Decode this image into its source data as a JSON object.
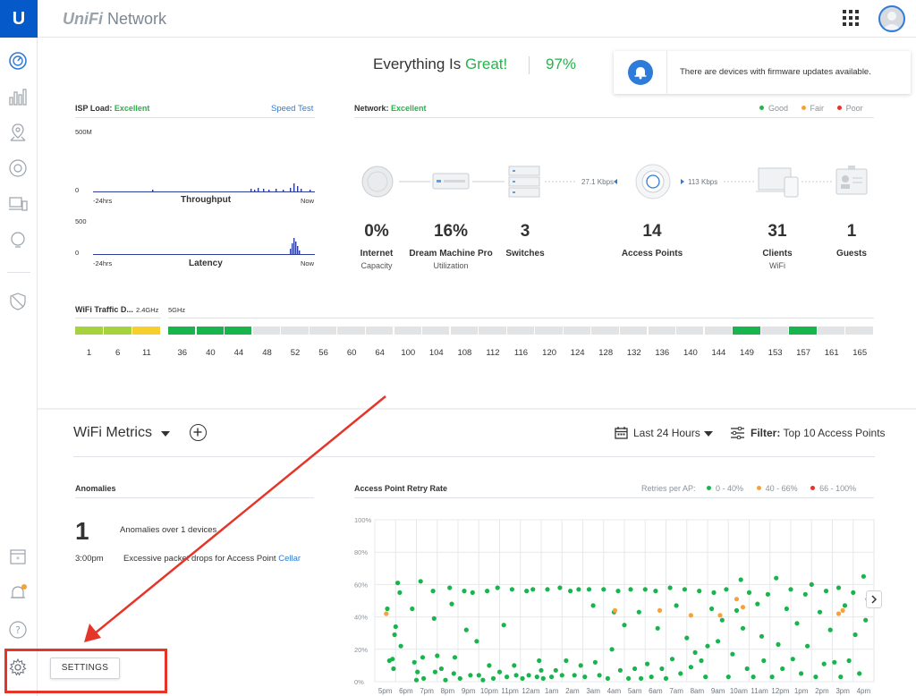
{
  "app": {
    "logo_letter": "U",
    "brand": "UniFi",
    "product": "Network"
  },
  "status": {
    "prefix": "Everything Is",
    "state": "Great!",
    "score": "97%"
  },
  "notification": {
    "text": "There are devices with firmware updates available."
  },
  "isp_load": {
    "label": "ISP Load:",
    "status": "Excellent",
    "speed_test": "Speed Test",
    "throughput": {
      "title": "Throughput",
      "ymax": "500M",
      "ymin": "0",
      "x_start": "-24hrs",
      "x_end": "Now"
    },
    "latency": {
      "title": "Latency",
      "ymax": "500",
      "ymin": "0",
      "x_start": "-24hrs",
      "x_end": "Now"
    }
  },
  "network": {
    "label": "Network:",
    "status": "Excellent",
    "legend": [
      {
        "label": "Good",
        "color": "#27b24a"
      },
      {
        "label": "Fair",
        "color": "#f5a23a"
      },
      {
        "label": "Poor",
        "color": "#e53529"
      }
    ],
    "speed_in": "27.1 Kbps",
    "speed_out": "113 Kbps",
    "nodes": [
      {
        "value": "0%",
        "label": "Internet",
        "sub": "Capacity"
      },
      {
        "value": "16%",
        "label": "Dream Machine Pro",
        "sub": "Utilization"
      },
      {
        "value": "3",
        "label": "Switches",
        "sub": ""
      },
      {
        "value": "14",
        "label": "Access Points",
        "sub": ""
      },
      {
        "value": "31",
        "label": "Clients",
        "sub": "WiFi"
      },
      {
        "value": "1",
        "label": "Guests",
        "sub": ""
      }
    ]
  },
  "wifi_traffic": {
    "label": "WiFi Traffic D...",
    "band24": "2.4GHz",
    "band5": "5GHz",
    "channels24": [
      "1",
      "6",
      "11"
    ],
    "colors24": [
      "#a6d23e",
      "#a6d23e",
      "#f6cf2f"
    ],
    "channels5": [
      "36",
      "40",
      "44",
      "48",
      "52",
      "56",
      "60",
      "64",
      "100",
      "104",
      "108",
      "112",
      "116",
      "120",
      "124",
      "128",
      "132",
      "136",
      "140",
      "144",
      "149",
      "153",
      "157",
      "161",
      "165"
    ],
    "active5": [
      "36",
      "40",
      "44",
      "149",
      "157"
    ],
    "active_color": "#19b44e",
    "idle_color": "#e1e3e5"
  },
  "metrics": {
    "title": "WiFi Metrics",
    "range": "Last 24 Hours",
    "filter_prefix": "Filter:",
    "filter_value": "Top 10 Access Points",
    "anomalies": {
      "title": "Anomalies",
      "count": "1",
      "desc": "Anomalies over 1 devices",
      "time": "3:00pm",
      "message": "Excessive packet drops for Access Point",
      "device": "Cellar"
    },
    "retry": {
      "title": "Access Point Retry Rate",
      "legend_label": "Retries per AP:",
      "legend": [
        {
          "label": "0 - 40%",
          "color": "#19b44e"
        },
        {
          "label": "40 - 66%",
          "color": "#f5a23a"
        },
        {
          "label": "66 - 100%",
          "color": "#e53529"
        }
      ]
    }
  },
  "settings_tooltip": "SETTINGS",
  "chart_data": {
    "type": "scatter",
    "title": "Access Point Retry Rate",
    "y_ticks": [
      "100%",
      "80%",
      "60%",
      "40%",
      "20%",
      "0%"
    ],
    "ylim": [
      0,
      100
    ],
    "x_ticks": [
      "5pm",
      "6pm",
      "7pm",
      "8pm",
      "9pm",
      "10pm",
      "11pm",
      "12am",
      "1am",
      "2am",
      "3am",
      "4am",
      "5am",
      "6am",
      "7am",
      "8am",
      "9am",
      "10am",
      "11am",
      "12pm",
      "1pm",
      "2pm",
      "3pm",
      "4pm"
    ],
    "series": [
      {
        "name": "0 - 40%",
        "color": "#19b44e",
        "points": [
          [
            0.1,
            45
          ],
          [
            0.2,
            13
          ],
          [
            0.35,
            14
          ],
          [
            0.45,
            29
          ],
          [
            0.5,
            34
          ],
          [
            0.4,
            8
          ],
          [
            0.6,
            61
          ],
          [
            0.7,
            55
          ],
          [
            0.75,
            22
          ],
          [
            1.3,
            45
          ],
          [
            1.4,
            12
          ],
          [
            1.5,
            1
          ],
          [
            1.55,
            6
          ],
          [
            1.7,
            62
          ],
          [
            1.8,
            15
          ],
          [
            1.85,
            2
          ],
          [
            2.3,
            56
          ],
          [
            2.35,
            39
          ],
          [
            2.4,
            6
          ],
          [
            2.5,
            16
          ],
          [
            2.7,
            8
          ],
          [
            2.9,
            1
          ],
          [
            3.1,
            58
          ],
          [
            3.2,
            48
          ],
          [
            3.3,
            5
          ],
          [
            3.35,
            15
          ],
          [
            3.6,
            2
          ],
          [
            3.8,
            56
          ],
          [
            3.9,
            32
          ],
          [
            4.1,
            4
          ],
          [
            4.2,
            55
          ],
          [
            4.4,
            25
          ],
          [
            4.5,
            4
          ],
          [
            4.7,
            1
          ],
          [
            4.9,
            56
          ],
          [
            5.0,
            10
          ],
          [
            5.2,
            2
          ],
          [
            5.4,
            58
          ],
          [
            5.5,
            6
          ],
          [
            5.7,
            35
          ],
          [
            5.85,
            3
          ],
          [
            6.1,
            57
          ],
          [
            6.2,
            10
          ],
          [
            6.3,
            4
          ],
          [
            6.6,
            2
          ],
          [
            6.8,
            56
          ],
          [
            6.9,
            4
          ],
          [
            7.1,
            57
          ],
          [
            7.3,
            3
          ],
          [
            7.4,
            13
          ],
          [
            7.5,
            7
          ],
          [
            7.6,
            2
          ],
          [
            7.8,
            57
          ],
          [
            8.0,
            3
          ],
          [
            8.2,
            7
          ],
          [
            8.4,
            58
          ],
          [
            8.5,
            4
          ],
          [
            8.7,
            13
          ],
          [
            8.9,
            56
          ],
          [
            9.1,
            4
          ],
          [
            9.3,
            57
          ],
          [
            9.4,
            10
          ],
          [
            9.6,
            3
          ],
          [
            9.8,
            57
          ],
          [
            10.0,
            47
          ],
          [
            10.1,
            12
          ],
          [
            10.3,
            4
          ],
          [
            10.5,
            57
          ],
          [
            10.7,
            2
          ],
          [
            10.9,
            20
          ],
          [
            11.0,
            43
          ],
          [
            11.2,
            56
          ],
          [
            11.3,
            7
          ],
          [
            11.5,
            35
          ],
          [
            11.7,
            2
          ],
          [
            11.8,
            57
          ],
          [
            12.0,
            8
          ],
          [
            12.2,
            43
          ],
          [
            12.3,
            2
          ],
          [
            12.5,
            57
          ],
          [
            12.6,
            11
          ],
          [
            12.8,
            3
          ],
          [
            13.0,
            56
          ],
          [
            13.1,
            33
          ],
          [
            13.3,
            8
          ],
          [
            13.5,
            2
          ],
          [
            13.7,
            58
          ],
          [
            13.8,
            14
          ],
          [
            14.0,
            47
          ],
          [
            14.2,
            5
          ],
          [
            14.4,
            57
          ],
          [
            14.5,
            27
          ],
          [
            14.7,
            9
          ],
          [
            14.9,
            18
          ],
          [
            15.1,
            56
          ],
          [
            15.2,
            13
          ],
          [
            15.4,
            3
          ],
          [
            15.5,
            22
          ],
          [
            15.7,
            45
          ],
          [
            15.8,
            55
          ],
          [
            16.0,
            25
          ],
          [
            16.2,
            38
          ],
          [
            16.4,
            57
          ],
          [
            16.5,
            3
          ],
          [
            16.7,
            17
          ],
          [
            16.9,
            44
          ],
          [
            17.1,
            63
          ],
          [
            17.2,
            33
          ],
          [
            17.4,
            8
          ],
          [
            17.5,
            55
          ],
          [
            17.7,
            3
          ],
          [
            17.9,
            48
          ],
          [
            18.1,
            28
          ],
          [
            18.2,
            13
          ],
          [
            18.4,
            54
          ],
          [
            18.6,
            3
          ],
          [
            18.8,
            64
          ],
          [
            18.9,
            23
          ],
          [
            19.1,
            8
          ],
          [
            19.3,
            45
          ],
          [
            19.5,
            57
          ],
          [
            19.6,
            14
          ],
          [
            19.8,
            36
          ],
          [
            20.0,
            5
          ],
          [
            20.2,
            54
          ],
          [
            20.3,
            22
          ],
          [
            20.5,
            60
          ],
          [
            20.7,
            3
          ],
          [
            20.9,
            43
          ],
          [
            21.1,
            11
          ],
          [
            21.2,
            56
          ],
          [
            21.4,
            32
          ],
          [
            21.6,
            12
          ],
          [
            21.8,
            58
          ],
          [
            21.9,
            3
          ],
          [
            22.1,
            47
          ],
          [
            22.3,
            13
          ],
          [
            22.5,
            55
          ],
          [
            22.6,
            29
          ],
          [
            22.8,
            5
          ],
          [
            23.0,
            65
          ],
          [
            23.1,
            38
          ],
          [
            23.2,
            51
          ]
        ]
      },
      {
        "name": "40 - 66%",
        "color": "#f5a23a",
        "points": [
          [
            0.05,
            42
          ],
          [
            11.05,
            44
          ],
          [
            13.2,
            44
          ],
          [
            14.7,
            41
          ],
          [
            16.1,
            41
          ],
          [
            16.9,
            51
          ],
          [
            17.2,
            46
          ],
          [
            21.8,
            42
          ],
          [
            22.0,
            44
          ]
        ]
      },
      {
        "name": "66 - 100%",
        "color": "#e53529",
        "points": []
      }
    ]
  }
}
